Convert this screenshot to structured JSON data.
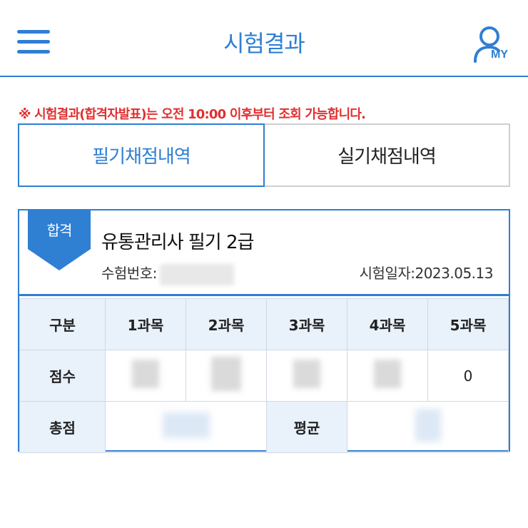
{
  "header": {
    "title": "시험결과",
    "my_label": "MY",
    "menu_icon": "hamburger-menu-icon",
    "my_icon": "user-icon"
  },
  "notice": "※ 시험결과(합격자발표)는 오전 10:00 이후부터 조회 가능합니다.",
  "tabs": [
    {
      "label": "필기채점내역",
      "active": true
    },
    {
      "label": "실기채점내역",
      "active": false
    }
  ],
  "result": {
    "badge": "합격",
    "exam_name": "유통관리사 필기 2급",
    "exam_no_label": "수험번호:",
    "exam_date": "시험일자:2023.05.13",
    "table": {
      "headers": [
        "구분",
        "1과목",
        "2과목",
        "3과목",
        "4과목",
        "5과목"
      ],
      "score_label": "점수",
      "subject5_score": "0",
      "total_label": "총점",
      "average_label": "평균"
    }
  },
  "colors": {
    "accent": "#2f7fd3",
    "notice": "#e03030",
    "table_header_bg": "#e9f1fb"
  }
}
